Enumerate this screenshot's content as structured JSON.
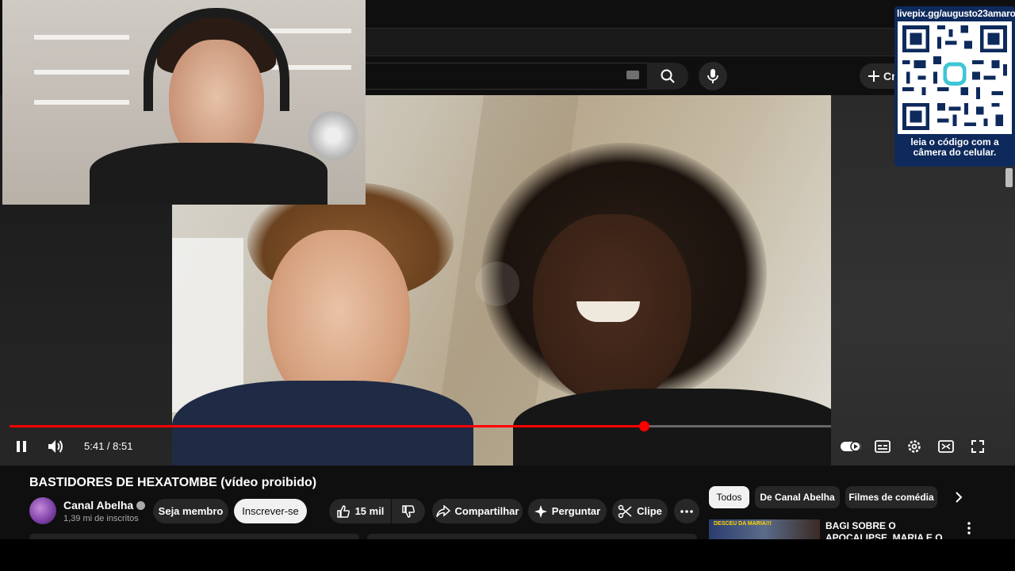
{
  "header": {
    "create_label": "Cr",
    "icons": [
      "keyboard-icon",
      "search-icon",
      "mic-icon",
      "plus-icon"
    ]
  },
  "overlay": {
    "qr_url": "livepix.gg/augusto23amaro",
    "qr_caption_line1": "leia o código com a",
    "qr_caption_line2": "câmera do celular."
  },
  "player": {
    "current_time": "5:41",
    "duration": "8:51",
    "time_display": "5:41 / 8:51",
    "progress_fraction": 0.772,
    "accent_color": "#ff0000"
  },
  "video": {
    "title": "BASTIDORES DE HEXATOMBE (vídeo proibido)",
    "channel_name": "Canal Abelha",
    "subscribers": "1,39 mi de inscritos",
    "join_label": "Seja membro",
    "subscribe_label": "Inscrever-se",
    "likes": "15 mil",
    "share_label": "Compartilhar",
    "ask_label": "Perguntar",
    "clip_label": "Clipe"
  },
  "recommendations": {
    "chips": [
      "Todos",
      "De Canal Abelha",
      "Filmes de comédia"
    ],
    "first_item": {
      "title": "BAGI SOBRE O APOCALIPSE, MARIA E O PLANO DE KIAN!!!",
      "thumb_text": "DESCEU DA MARIA!!!"
    }
  }
}
